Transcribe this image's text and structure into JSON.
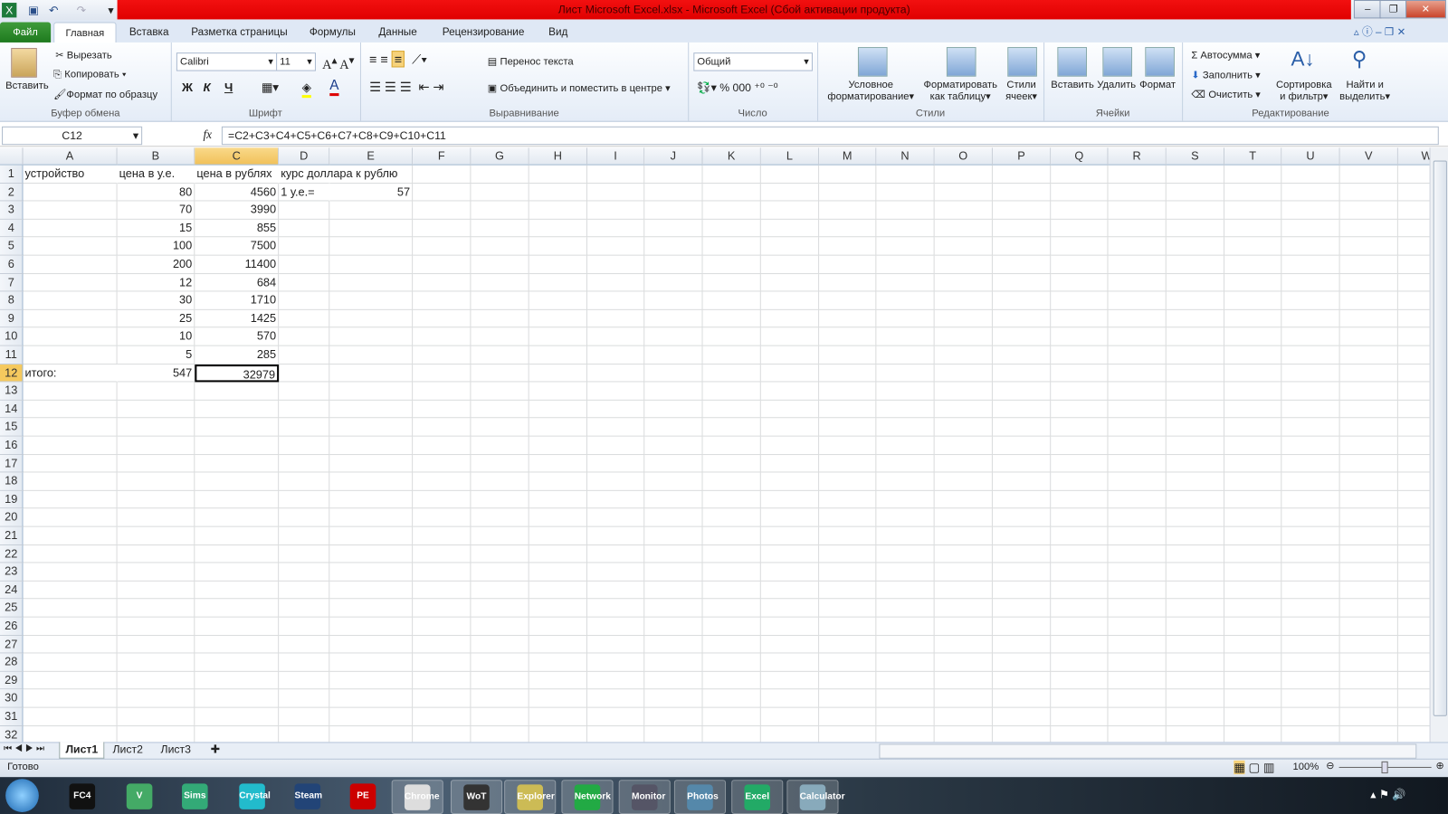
{
  "window": {
    "title": "Лист Microsoft Excel.xlsx - Microsoft Excel (Сбой активации продукта)"
  },
  "ribbon_tabs": [
    "Файл",
    "Главная",
    "Вставка",
    "Разметка страницы",
    "Формулы",
    "Данные",
    "Рецензирование",
    "Вид"
  ],
  "clipboard": {
    "paste": "Вставить",
    "cut": "Вырезать",
    "copy": "Копировать",
    "format_painter": "Формат по образцу",
    "label": "Буфер обмена"
  },
  "font": {
    "name": "Calibri",
    "size": "11",
    "bold": "Ж",
    "italic": "К",
    "underline": "Ч",
    "label": "Шрифт"
  },
  "alignment": {
    "wrap": "Перенос текста",
    "merge": "Объединить и поместить в центре",
    "label": "Выравнивание"
  },
  "number": {
    "format": "Общий",
    "percent": "%",
    "thousands": "000",
    "label": "Число"
  },
  "styles": {
    "conditional": [
      "Условное",
      "форматирование"
    ],
    "table": [
      "Форматировать",
      "как таблицу"
    ],
    "cell": [
      "Стили",
      "ячеек"
    ],
    "label": "Стили"
  },
  "cells": {
    "insert": "Вставить",
    "delete": "Удалить",
    "format": "Формат",
    "label": "Ячейки"
  },
  "editing": {
    "autosum": "Автосумма",
    "fill": "Заполнить",
    "clear": "Очистить",
    "sort": [
      "Сортировка",
      "и фильтр"
    ],
    "find": [
      "Найти и",
      "выделить"
    ],
    "label": "Редактирование"
  },
  "formula_bar": {
    "name_box": "C12",
    "fx": "fx",
    "formula": "=C2+C3+C4+C5+C6+C7+C8+C9+C10+C11"
  },
  "columns": [
    "A",
    "B",
    "C",
    "D",
    "E",
    "F",
    "G",
    "H",
    "I",
    "J",
    "K",
    "L",
    "M",
    "N",
    "O",
    "P",
    "Q",
    "R",
    "S",
    "T",
    "U",
    "V",
    "W"
  ],
  "selected": {
    "col": "C",
    "row": 12
  },
  "rows": [
    {
      "n": 1,
      "A": "устройство",
      "B": "цена в у.е.",
      "C": "цена в рублях",
      "D": "курс доллара к рублю"
    },
    {
      "n": 2,
      "B": "80",
      "C": "4560",
      "D": "1 у.е.=",
      "E": "57"
    },
    {
      "n": 3,
      "B": "70",
      "C": "3990"
    },
    {
      "n": 4,
      "B": "15",
      "C": "855"
    },
    {
      "n": 5,
      "B": "100",
      "C": "7500"
    },
    {
      "n": 6,
      "B": "200",
      "C": "11400"
    },
    {
      "n": 7,
      "B": "12",
      "C": "684"
    },
    {
      "n": 8,
      "B": "30",
      "C": "1710"
    },
    {
      "n": 9,
      "B": "25",
      "C": "1425"
    },
    {
      "n": 10,
      "B": "10",
      "C": "570"
    },
    {
      "n": 11,
      "B": "5",
      "C": "285"
    },
    {
      "n": 12,
      "A": "итого:",
      "B": "547",
      "C": "32979"
    }
  ],
  "row_count": 32,
  "sheets": [
    "Лист1",
    "Лист2",
    "Лист3"
  ],
  "status": {
    "ready": "Готово",
    "zoom": "100%"
  },
  "taskbar": [
    "FC4",
    "V",
    "Sims",
    "Crystal",
    "Steam",
    "PE",
    "Chrome",
    "WoT",
    "Explorer",
    "Network",
    "Monitor",
    "Photos",
    "Excel",
    "Calculator"
  ]
}
